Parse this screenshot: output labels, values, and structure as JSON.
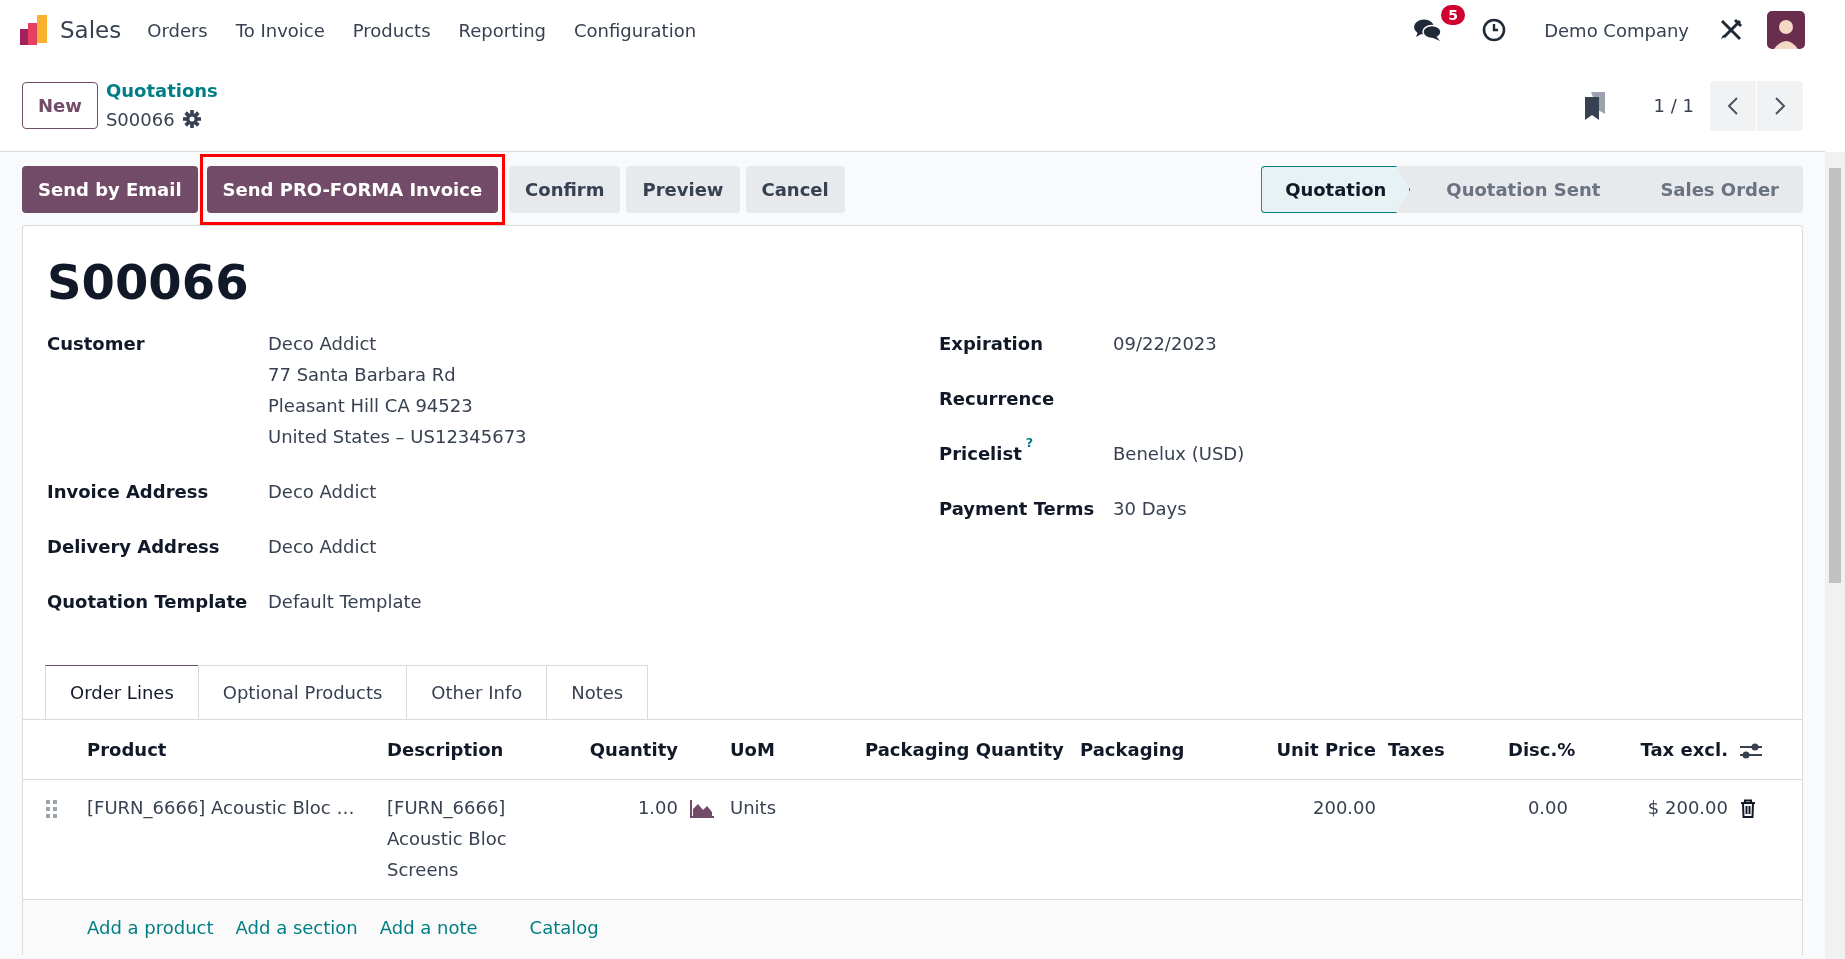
{
  "app": {
    "name": "Sales"
  },
  "menu": [
    "Orders",
    "To Invoice",
    "Products",
    "Reporting",
    "Configuration"
  ],
  "systray": {
    "messages_count": "5",
    "company": "Demo Company"
  },
  "new_button": "New",
  "breadcrumb": {
    "parent": "Quotations",
    "current": "S00066"
  },
  "pager": {
    "value": "1 / 1"
  },
  "actions": [
    {
      "label": "Send by Email",
      "kind": "primary",
      "highlighted": false
    },
    {
      "label": "Send PRO-FORMA Invoice",
      "kind": "primary",
      "highlighted": true
    },
    {
      "label": "Confirm",
      "kind": "secondary",
      "highlighted": false
    },
    {
      "label": "Preview",
      "kind": "secondary",
      "highlighted": false
    },
    {
      "label": "Cancel",
      "kind": "secondary",
      "highlighted": false
    }
  ],
  "stages": [
    {
      "label": "Quotation",
      "selected": true
    },
    {
      "label": "Quotation Sent",
      "selected": false
    },
    {
      "label": "Sales Order",
      "selected": false
    }
  ],
  "record": {
    "title": "S00066",
    "left_fields": [
      {
        "label": "Customer",
        "lines": [
          "Deco Addict",
          "77 Santa Barbara Rd",
          "Pleasant Hill CA 94523",
          "United States – US12345673"
        ]
      },
      {
        "label": "Invoice Address",
        "lines": [
          "Deco Addict"
        ]
      },
      {
        "label": "Delivery Address",
        "lines": [
          "Deco Addict"
        ]
      },
      {
        "label": "Quotation Template",
        "lines": [
          "Default Template"
        ]
      }
    ],
    "right_fields": [
      {
        "label": "Expiration",
        "lines": [
          "09/22/2023"
        ]
      },
      {
        "label": "Recurrence"
      },
      {
        "label": "Pricelist",
        "help": "?",
        "lines": [
          "Benelux (USD)"
        ]
      },
      {
        "label": "Payment Terms",
        "lines": [
          "30 Days"
        ]
      }
    ]
  },
  "tabs": [
    {
      "label": "Order Lines",
      "selected": true
    },
    {
      "label": "Optional Products",
      "selected": false
    },
    {
      "label": "Other Info",
      "selected": false
    },
    {
      "label": "Notes",
      "selected": false
    }
  ],
  "table": {
    "columns": [
      "Product",
      "Description",
      "Quantity",
      "UoM",
      "Packaging Quantity",
      "Packaging",
      "Unit Price",
      "Taxes",
      "Disc.%",
      "Tax excl."
    ],
    "rows": [
      {
        "cells": [
          "[FURN_6666] Acoustic Bloc …",
          "[FURN_6666] Acoustic Bloc Screens",
          "1.00",
          "Units",
          null,
          null,
          "200.00",
          null,
          "0.00",
          "$ 200.00"
        ]
      }
    ]
  },
  "add_links": [
    "Add a product",
    "Add a section",
    "Add a note",
    "Catalog"
  ]
}
